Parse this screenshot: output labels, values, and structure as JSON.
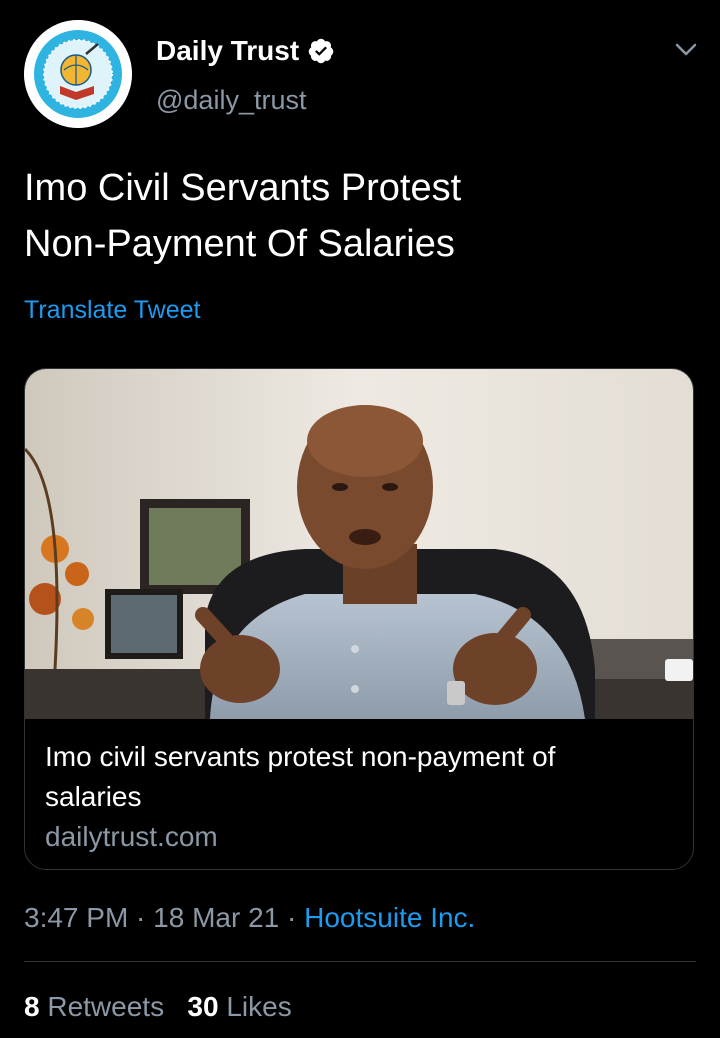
{
  "account": {
    "display_name": "Daily Trust",
    "handle": "@daily_trust",
    "verified_icon": "verified-badge-icon",
    "avatar_icon": "daily-trust-logo"
  },
  "tweet": {
    "text_lines": [
      "Imo Civil Servants Protest",
      "Non-Payment Of Salaries"
    ],
    "translate_label": "Translate Tweet"
  },
  "card": {
    "title_lines": [
      "Imo civil servants protest non-payment of",
      "salaries"
    ],
    "domain": "dailytrust.com"
  },
  "meta": {
    "time": "3:47 PM",
    "separator": " · ",
    "date": "18 Mar 21",
    "source": "Hootsuite Inc."
  },
  "stats": {
    "retweets_count": "8",
    "retweets_label": "Retweets",
    "likes_count": "30",
    "likes_label": "Likes"
  },
  "colors": {
    "background": "#000000",
    "accent": "#1d9bf0",
    "secondary_text": "#8b98a5",
    "divider": "#2f3336"
  }
}
